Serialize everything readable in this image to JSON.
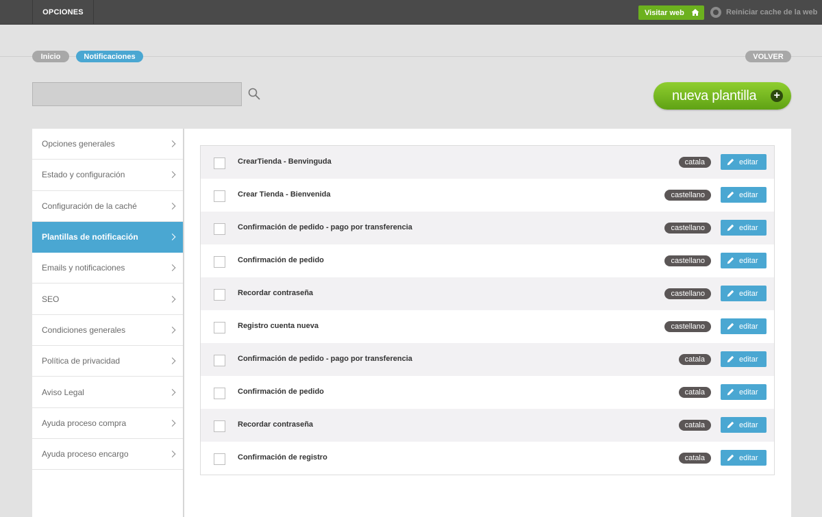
{
  "topbar": {
    "tab": "OPCIONES",
    "visit_label": "Visitar web",
    "cache_label": "Reiniciar cache de la web"
  },
  "breadcrumb": {
    "home": "Inicio",
    "current": "Notificaciones",
    "back": "VOLVER"
  },
  "search": {
    "placeholder": ""
  },
  "new_button": {
    "label": "nueva plantilla"
  },
  "sidebar": {
    "items": [
      {
        "label": "Opciones generales"
      },
      {
        "label": "Estado y configuración"
      },
      {
        "label": "Configuración de la caché"
      },
      {
        "label": "Plantillas de notificación",
        "active": true
      },
      {
        "label": "Emails y notificaciones"
      },
      {
        "label": "SEO"
      },
      {
        "label": "Condiciones generales"
      },
      {
        "label": "Política de privacidad"
      },
      {
        "label": "Aviso Legal"
      },
      {
        "label": "Ayuda proceso compra"
      },
      {
        "label": "Ayuda proceso encargo"
      }
    ]
  },
  "templates": {
    "edit_label": "editar",
    "rows": [
      {
        "title": "CrearTienda - Benvinguda",
        "lang": "catala"
      },
      {
        "title": "Crear Tienda - Bienvenida",
        "lang": "castellano"
      },
      {
        "title": "Confirmación de pedido - pago por transferencia",
        "lang": "castellano"
      },
      {
        "title": "Confirmación de pedido",
        "lang": "castellano"
      },
      {
        "title": "Recordar contraseña",
        "lang": "castellano"
      },
      {
        "title": "Registro cuenta nueva",
        "lang": "castellano"
      },
      {
        "title": "Confirmación de pedido - pago por transferencia",
        "lang": "catala"
      },
      {
        "title": "Confirmación de pedido",
        "lang": "catala"
      },
      {
        "title": "Recordar contraseña",
        "lang": "catala"
      },
      {
        "title": "Confirmación de registro",
        "lang": "catala"
      }
    ]
  },
  "colors": {
    "accent_blue": "#4aa7d2",
    "accent_green": "#6cb11e",
    "topbar": "#4a4a4a",
    "lang_badge": "#5b5656"
  }
}
